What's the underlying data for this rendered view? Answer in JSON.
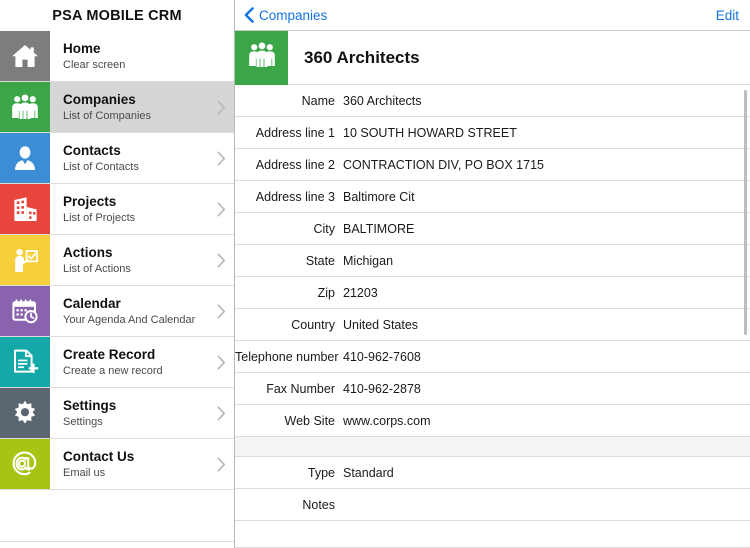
{
  "sidebar": {
    "title": "PSA MOBILE CRM",
    "items": [
      {
        "id": "home",
        "label": "Home",
        "subtitle": "Clear screen",
        "icon": "house-icon",
        "color": "#7d7d7d",
        "selected": false,
        "chevron": false
      },
      {
        "id": "companies",
        "label": "Companies",
        "subtitle": "List of Companies",
        "icon": "people-group-icon",
        "color": "#3aa648",
        "selected": true,
        "chevron": true
      },
      {
        "id": "contacts",
        "label": "Contacts",
        "subtitle": "List of Contacts",
        "icon": "person-icon",
        "color": "#3b8ed6",
        "selected": false,
        "chevron": true
      },
      {
        "id": "projects",
        "label": "Projects",
        "subtitle": "List of Projects",
        "icon": "buildings-icon",
        "color": "#e8453c",
        "selected": false,
        "chevron": true
      },
      {
        "id": "actions",
        "label": "Actions",
        "subtitle": "List of Actions",
        "icon": "presenter-icon",
        "color": "#f7cf3a",
        "selected": false,
        "chevron": true
      },
      {
        "id": "calendar",
        "label": "Calendar",
        "subtitle": "Your Agenda And Calendar",
        "icon": "calendar-clock-icon",
        "color": "#8a63ae",
        "selected": false,
        "chevron": true
      },
      {
        "id": "create-record",
        "label": "Create Record",
        "subtitle": "Create a new record",
        "icon": "new-document-icon",
        "color": "#14a8a8",
        "selected": false,
        "chevron": true
      },
      {
        "id": "settings",
        "label": "Settings",
        "subtitle": "Settings",
        "icon": "gear-icon",
        "color": "#5c6670",
        "selected": false,
        "chevron": true
      },
      {
        "id": "contact-us",
        "label": "Contact Us",
        "subtitle": "Email us",
        "icon": "at-sign-icon",
        "color": "#a9c312",
        "selected": false,
        "chevron": true
      }
    ]
  },
  "detail": {
    "back_label": "Companies",
    "edit_label": "Edit",
    "record_title": "360 Architects",
    "record_icon": "people-group-icon",
    "record_icon_color": "#3aa648",
    "fields": [
      {
        "label": "Name",
        "value": "360 Architects"
      },
      {
        "label": "Address line 1",
        "value": "10 SOUTH HOWARD STREET"
      },
      {
        "label": "Address line 2",
        "value": "CONTRACTION DIV, PO BOX 1715"
      },
      {
        "label": "Address line 3",
        "value": "Baltimore Cit"
      },
      {
        "label": "City",
        "value": "BALTIMORE"
      },
      {
        "label": "State",
        "value": "Michigan"
      },
      {
        "label": "Zip",
        "value": "21203"
      },
      {
        "label": "Country",
        "value": "United States"
      },
      {
        "label": "Telephone number",
        "value": "410-962-7608"
      },
      {
        "label": "Fax Number",
        "value": "410-962-2878"
      },
      {
        "label": "Web Site",
        "value": "www.corps.com"
      },
      {
        "spacer": true
      },
      {
        "label": "Type",
        "value": "Standard"
      },
      {
        "label": "Notes",
        "value": ""
      }
    ]
  },
  "colors": {
    "link": "#1474e0",
    "selected_row": "#d6d6d6",
    "separator": "#dcdcdc",
    "spacer_band": "#f4f4f4"
  }
}
